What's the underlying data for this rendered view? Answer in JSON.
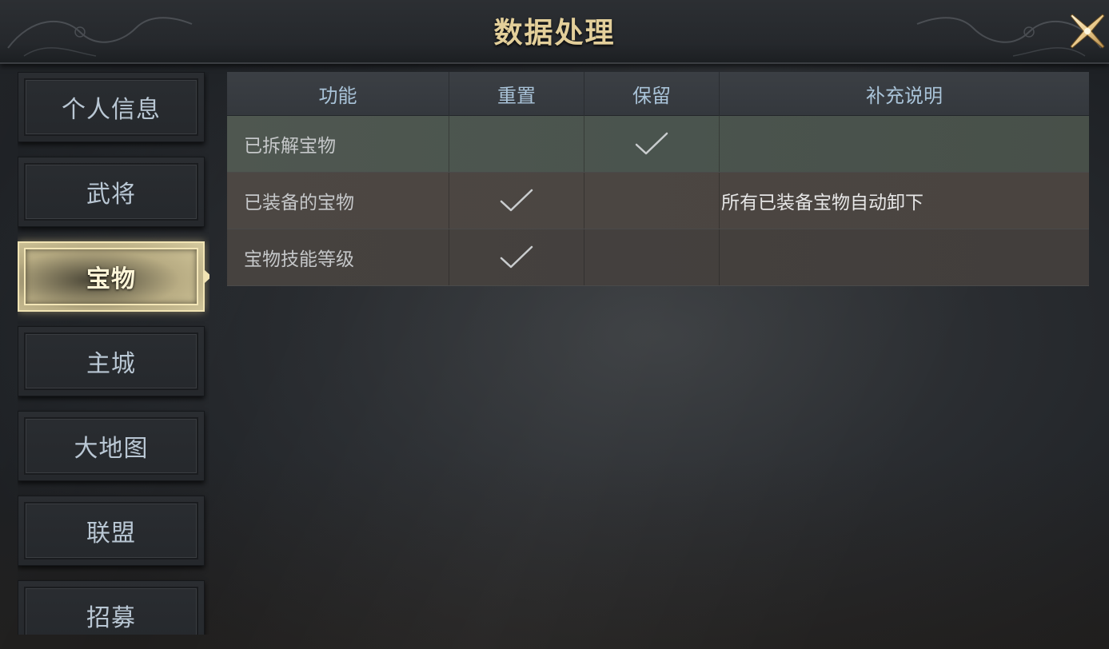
{
  "header": {
    "title": "数据处理",
    "close_icon": "close-x-icon"
  },
  "sidebar": {
    "items": [
      {
        "label": "个人信息",
        "active": false
      },
      {
        "label": "武将",
        "active": false
      },
      {
        "label": "宝物",
        "active": true
      },
      {
        "label": "主城",
        "active": false
      },
      {
        "label": "大地图",
        "active": false
      },
      {
        "label": "联盟",
        "active": false
      },
      {
        "label": "招募",
        "active": false
      }
    ]
  },
  "table": {
    "columns": [
      "功能",
      "重置",
      "保留",
      "补充说明"
    ],
    "rows": [
      {
        "name": "已拆解宝物",
        "reset": false,
        "keep": true,
        "note": ""
      },
      {
        "name": "已装备的宝物",
        "reset": true,
        "keep": false,
        "note": "所有已装备宝物自动卸下"
      },
      {
        "name": "宝物技能等级",
        "reset": true,
        "keep": false,
        "note": ""
      }
    ]
  },
  "colors": {
    "title": "#e3cf9a",
    "header_text": "#a9c3d8",
    "sidebar_text": "#b9c7d4",
    "active_tab": "#d6cb9f",
    "highlight_row": "#4f5750"
  }
}
